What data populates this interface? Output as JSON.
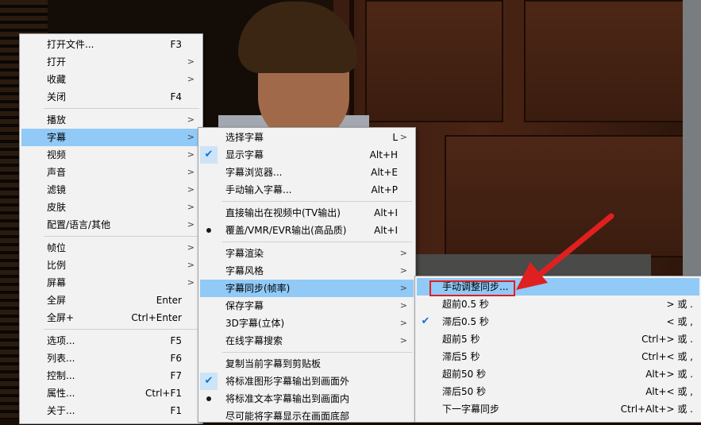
{
  "menu_main": {
    "items": [
      {
        "label": "打开文件...",
        "shortcut": "F3",
        "submenu": false
      },
      {
        "label": "打开",
        "shortcut": "",
        "submenu": true
      },
      {
        "label": "收藏",
        "shortcut": "",
        "submenu": true
      },
      {
        "label": "关闭",
        "shortcut": "F4",
        "submenu": false
      },
      {
        "label": "播放",
        "shortcut": "",
        "submenu": true
      },
      {
        "label": "字幕",
        "shortcut": "",
        "submenu": true,
        "highlighted": true
      },
      {
        "label": "视频",
        "shortcut": "",
        "submenu": true
      },
      {
        "label": "声音",
        "shortcut": "",
        "submenu": true
      },
      {
        "label": "滤镜",
        "shortcut": "",
        "submenu": true
      },
      {
        "label": "皮肤",
        "shortcut": "",
        "submenu": true
      },
      {
        "label": "配置/语言/其他",
        "shortcut": "",
        "submenu": true
      },
      {
        "label": "帧位",
        "shortcut": "",
        "submenu": true
      },
      {
        "label": "比例",
        "shortcut": "",
        "submenu": true
      },
      {
        "label": "屏幕",
        "shortcut": "",
        "submenu": true
      },
      {
        "label": "全屏",
        "shortcut": "Enter",
        "submenu": false
      },
      {
        "label": "全屏+",
        "shortcut": "Ctrl+Enter",
        "submenu": false
      },
      {
        "label": "选项...",
        "shortcut": "F5",
        "submenu": false
      },
      {
        "label": "列表...",
        "shortcut": "F6",
        "submenu": false
      },
      {
        "label": "控制...",
        "shortcut": "F7",
        "submenu": false
      },
      {
        "label": "属性...",
        "shortcut": "Ctrl+F1",
        "submenu": false
      },
      {
        "label": "关于...",
        "shortcut": "F1",
        "submenu": false
      }
    ]
  },
  "menu_subtitle": {
    "items": [
      {
        "label": "选择字幕",
        "shortcut": "L",
        "submenu": true
      },
      {
        "label": "显示字幕",
        "shortcut": "Alt+H",
        "check": "check"
      },
      {
        "label": "字幕浏览器...",
        "shortcut": "Alt+E"
      },
      {
        "label": "手动输入字幕...",
        "shortcut": "Alt+P"
      },
      {
        "label": "直接输出在视频中(TV输出)",
        "shortcut": "Alt+I"
      },
      {
        "label": "覆盖/VMR/EVR输出(高品质)",
        "shortcut": "Alt+I",
        "check": "dot"
      },
      {
        "label": "字幕渲染",
        "submenu": true
      },
      {
        "label": "字幕风格",
        "submenu": true
      },
      {
        "label": "字幕同步(帧率)",
        "submenu": true,
        "highlighted": true
      },
      {
        "label": "保存字幕",
        "submenu": true
      },
      {
        "label": "3D字幕(立体)",
        "submenu": true
      },
      {
        "label": "在线字幕搜索",
        "submenu": true
      },
      {
        "label": "复制当前字幕到剪贴板"
      },
      {
        "label": "将标准图形字幕输出到画面外",
        "check": "check"
      },
      {
        "label": "将标准文本字幕输出到画面内",
        "check": "dot"
      },
      {
        "label": "尽可能将字幕显示在画面底部"
      }
    ]
  },
  "menu_sync": {
    "items": [
      {
        "label": "手动调整同步...",
        "shortcut": "",
        "highlighted": true
      },
      {
        "label": "超前0.5 秒",
        "shortcut": "> 或 ."
      },
      {
        "label": "滞后0.5 秒",
        "shortcut": "< 或 ,",
        "check": "check"
      },
      {
        "label": "超前5 秒",
        "shortcut": "Ctrl+> 或 ."
      },
      {
        "label": "滞后5 秒",
        "shortcut": "Ctrl+< 或 ,"
      },
      {
        "label": "超前50 秒",
        "shortcut": "Alt+> 或 ."
      },
      {
        "label": "滞后50 秒",
        "shortcut": "Alt+< 或 ,"
      },
      {
        "label": "下一字幕同步",
        "shortcut": "Ctrl+Alt+> 或 ."
      }
    ]
  },
  "colors": {
    "highlight": "#91c9f7",
    "menu_bg": "#f2f2f2",
    "annotation": "#e02020",
    "check": "#1a6ed8"
  },
  "icons": {
    "check": "check-icon",
    "dot": "radio-dot-icon",
    "arrow": "chevron-right-icon"
  }
}
